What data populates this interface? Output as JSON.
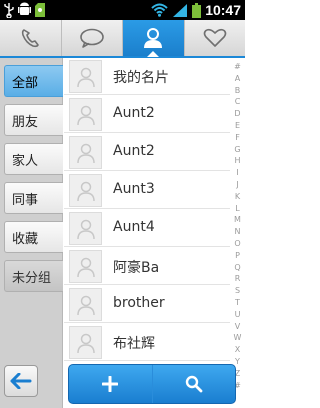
{
  "status_bar": {
    "clock": "10:47",
    "icons": [
      "usb-icon",
      "android-debug-icon",
      "sd-card-icon",
      "wifi-icon",
      "signal-icon",
      "battery-icon"
    ]
  },
  "tabs": [
    {
      "icon": "phone-icon",
      "active": false
    },
    {
      "icon": "message-icon",
      "active": false
    },
    {
      "icon": "contacts-icon",
      "active": true
    },
    {
      "icon": "favorites-heart-icon",
      "active": false
    }
  ],
  "groups": [
    {
      "label": "全部",
      "active": true
    },
    {
      "label": "朋友",
      "active": false
    },
    {
      "label": "家人",
      "active": false
    },
    {
      "label": "同事",
      "active": false
    },
    {
      "label": "收藏",
      "active": false
    },
    {
      "label": "未分组",
      "active": false
    }
  ],
  "contacts": [
    {
      "name": "我的名片"
    },
    {
      "name": "Aunt2"
    },
    {
      "name": "Aunt2"
    },
    {
      "name": "Aunt3"
    },
    {
      "name": "Aunt4"
    },
    {
      "name": "阿豪Ba"
    },
    {
      "name": "brother"
    },
    {
      "name": "布社辉"
    }
  ],
  "alphabet_index": [
    "#",
    "A",
    "B",
    "C",
    "D",
    "E",
    "F",
    "G",
    "H",
    "I",
    "J",
    "K",
    "L",
    "M",
    "N",
    "O",
    "P",
    "Q",
    "R",
    "S",
    "T",
    "U",
    "V",
    "W",
    "X",
    "Y",
    "Z",
    "#"
  ],
  "colors": {
    "accent_blue": "#1c88d7",
    "status_bar": "#000000",
    "group_bg": "#cfcfcf"
  }
}
